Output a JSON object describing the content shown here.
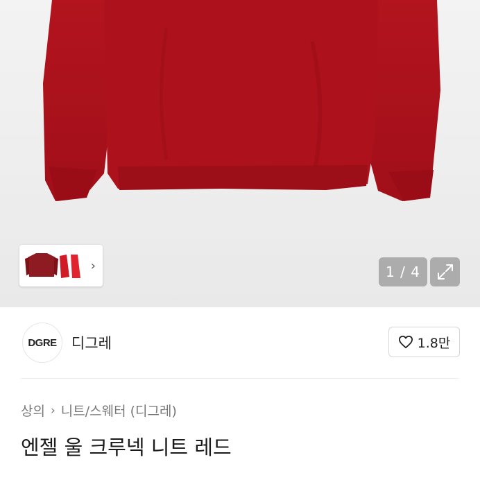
{
  "gallery": {
    "counter": "1 / 4",
    "expand_icon": "expand-icon",
    "thumbnail_more_icon": "chevron-right-icon",
    "product_color": "#b0151f"
  },
  "store": {
    "logo_text": "DGRE",
    "name": "디그레",
    "like_count": "1.8만",
    "like_icon": "heart-icon"
  },
  "breadcrumb": {
    "level1": "상의",
    "separator_icon": "chevron-right-icon",
    "level2": "니트/스웨터 (디그레)"
  },
  "product": {
    "title": "엔젤 울 크루넥 니트 레드"
  }
}
